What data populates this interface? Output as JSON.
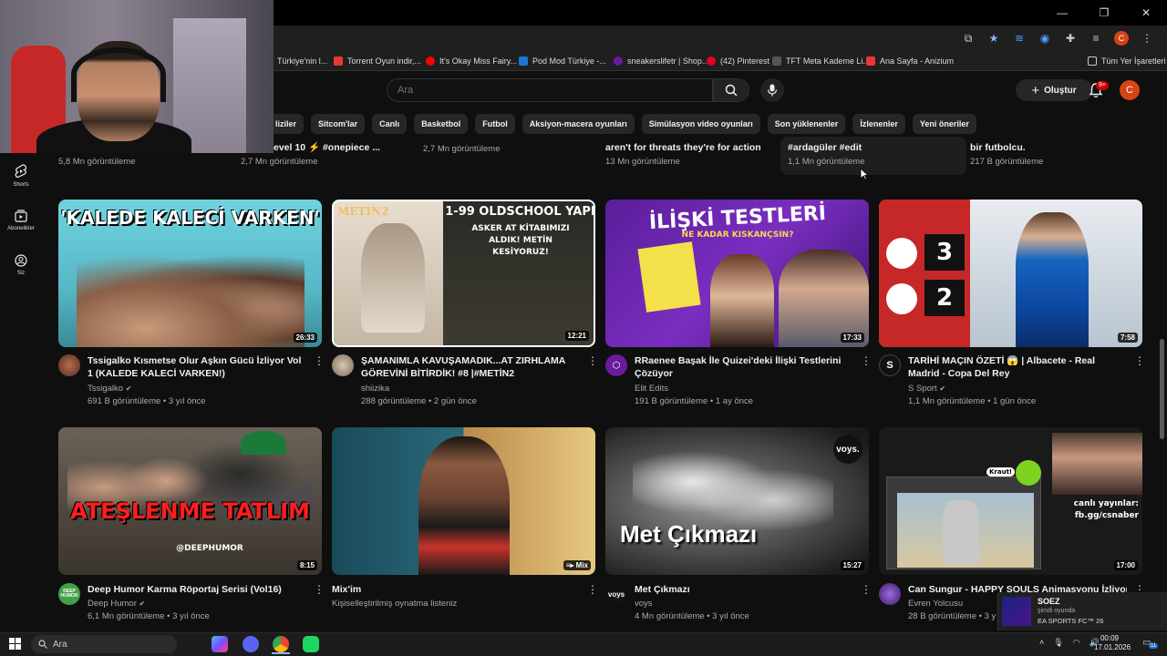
{
  "browser": {
    "bookmarks": [
      "Türkiye'nin l...",
      "Torrent Oyun indir,...",
      "It's Okay Miss Fairy...",
      "Pod Mod Türkiye -...",
      "sneakerslifetr | Shop...",
      "(42) Pinterest",
      "TFT Meta Kademe Li...",
      "Ana Sayfa - Anizium"
    ],
    "all_bookmarks": "Tüm Yer İşaretleri",
    "profile_letter": "C",
    "bookmark_colors": [
      "#888888",
      "#e53935",
      "#ff0000",
      "#1976d2",
      "#6a1b9a",
      "#e60023",
      "#555555",
      "#e53935"
    ]
  },
  "header": {
    "search_placeholder": "Ara",
    "create_label": "Oluştur",
    "notif_badge": "9+",
    "avatar_letter": "C"
  },
  "chips": [
    "liziler",
    "Sitcom'lar",
    "Canlı",
    "Basketbol",
    "Futbol",
    "Aksiyon-macera oyunları",
    "Simülasyon video oyunları",
    "Son yüklenenler",
    "İzlenenler",
    "Yeni öneriler"
  ],
  "sidebar": [
    {
      "icon": "shorts-icon",
      "label": "Shorts"
    },
    {
      "icon": "subscriptions-icon",
      "label": "Abonelikler"
    },
    {
      "icon": "you-icon",
      "label": "Siz"
    }
  ],
  "prev_row": [
    {
      "title": "",
      "meta": "5,8 Mn görüntüleme"
    },
    {
      "title": "evel 10 ⚡ #onepiece ...",
      "meta": "2,7 Mn görüntüleme"
    },
    {
      "title": "",
      "meta": "2,7 Mn görüntüleme"
    },
    {
      "title": "aren't for threats they're for action",
      "meta": "13 Mn görüntüleme"
    },
    {
      "title": "#ardagüler #edit",
      "meta": "1,1 Mn görüntüleme"
    },
    {
      "title": "bir futbolcu.",
      "meta": "217 B görüntüleme"
    }
  ],
  "videos": [
    {
      "title": "Tssigalko Kısmetse Olur Aşkın Gücü İzliyor Vol 1 (KALEDE KALECİ VARKEN!)",
      "channel": "Tssigalko",
      "meta": "691 B görüntüleme • 3 yıl önce",
      "duration": "26:33",
      "thumb_text": "'KALEDE KALECİ VARKEN'",
      "verified": true
    },
    {
      "title": "ŞAMANIMLA KAVUŞAMADIK...AT ZIRHLAMA GÖREVİNİ BİTİRDİK! #8 |#METİN2",
      "channel": "shiizika",
      "meta": "288 görüntüleme • 2 gün önce",
      "duration": "12:21",
      "thumb_text": "1-99 OLDSCHOOL YAPI",
      "thumb_sub": "ASKER AT KİTABIMIZI ALDIK! METİN KESİYORUZ!",
      "thumb_logo": "METIN2",
      "verified": false
    },
    {
      "title": "RRaenee Başak İle Quizei'deki İlişki Testlerini Çözüyor",
      "channel": "Elit Edits",
      "meta": "191 B görüntüleme • 1 ay önce",
      "duration": "17:33",
      "thumb_text": "İLİŞKİ TESTLERİ",
      "thumb_sub": "NE KADAR KISKANÇSIN?",
      "verified": false
    },
    {
      "title": "TARİHİ MAÇIN ÖZETİ 😱 | Albacete - Real Madrid - Copa Del Rey",
      "channel": "S Sport",
      "meta": "1,1 Mn görüntüleme • 1 gün önce",
      "duration": "7:58",
      "score_home": "3",
      "score_away": "2",
      "verified": true
    },
    {
      "title": "Deep Humor Karma Röportaj Serisi (Vol16)",
      "channel": "Deep Humor",
      "meta": "6,1 Mn görüntüleme • 3 yıl önce",
      "duration": "8:15",
      "thumb_text": "ATEŞLENME TATLIM",
      "thumb_sub": "@DEEPHUMOR",
      "avatar_text": "DEEP HUMOR",
      "verified": true
    },
    {
      "title": "Mix'im",
      "channel": "Kişiselleştirilmiş oynatma listeniz",
      "meta": "",
      "duration": "Mix",
      "verified": false
    },
    {
      "title": "Met Çıkmazı",
      "channel": "voys",
      "meta": "4 Mn görüntüleme • 3 yıl önce",
      "duration": "15:27",
      "thumb_text": "Met Çıkmazı",
      "thumb_logo": "voys.",
      "avatar_text": "voys",
      "verified": false
    },
    {
      "title": "Can Sungur - HAPPY SOULS Animasyonu İzliyor",
      "channel": "Evren Yolcusu",
      "meta": "28 B görüntüleme • 3 y",
      "duration": "17:00",
      "thumb_text": "canlı yayınlar: fb.gg/csnaber",
      "thumb_sub": "Kraut!",
      "verified": false
    }
  ],
  "notification": {
    "name": "SOEZ",
    "status": "şimdi oyunda",
    "game": "EA SPORTS FC™ 26"
  },
  "taskbar": {
    "search": "Ara",
    "time": "00:09",
    "date": "17.01.2026",
    "badge": "11"
  },
  "colors": {
    "accent": "#ff0000",
    "bg": "#0f0f0f",
    "chip": "#272727"
  }
}
